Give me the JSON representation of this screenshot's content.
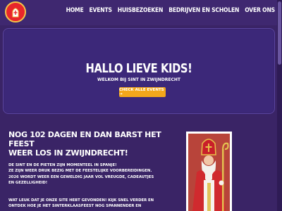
{
  "nav": {
    "logo_icon": "sinterklaas-mitre-logo",
    "items": [
      {
        "label": "HOME"
      },
      {
        "label": "EVENTS"
      },
      {
        "label": "HUISBEZOEKEN"
      },
      {
        "label": "BEDRIJVEN EN SCHOLEN"
      },
      {
        "label": "OVER ONS"
      }
    ]
  },
  "hero": {
    "title": "HALLO LIEVE KIDS!",
    "subtitle": "WELKOM BIJ SINT IN ZWIJNDRECHT",
    "button_label": "CHECK ALLE EVENTS →"
  },
  "intro": {
    "title_lines": [
      "NOG 102 DAGEN EN DAN BARST HET FEEST",
      "WEER LOS IN ZWIJNDRECHT!"
    ],
    "paragraph1_lines": [
      "DE SINT EN DE PIETEN ZIJN MOMENTEEL IN SPANJE!",
      "ZE ZIJN WEER DRUK BEZIG MET DE FEESTELIJKE VOORBEREIDINGEN.",
      "2026 WORDT WEER EEN GEWELDIG JAAR VOL VREUGDE, CADEAUTJES",
      "EN GEZELLIGHEID!"
    ],
    "paragraph2_lines": [
      "WAT LEUK DAT JE ONZE SITE HEBT GEVONDEN! KIJK SNEL VERDER EN",
      "ONTDEK HOE JE HET SINTERKLAASFEEST NOG SPANNENDER EN"
    ],
    "photo_icon": "sinterklaas-photo"
  },
  "colors": {
    "background": "#3a2466",
    "hero": "#3c2879",
    "button": "#f3a71b",
    "logo": "#e8262b"
  }
}
